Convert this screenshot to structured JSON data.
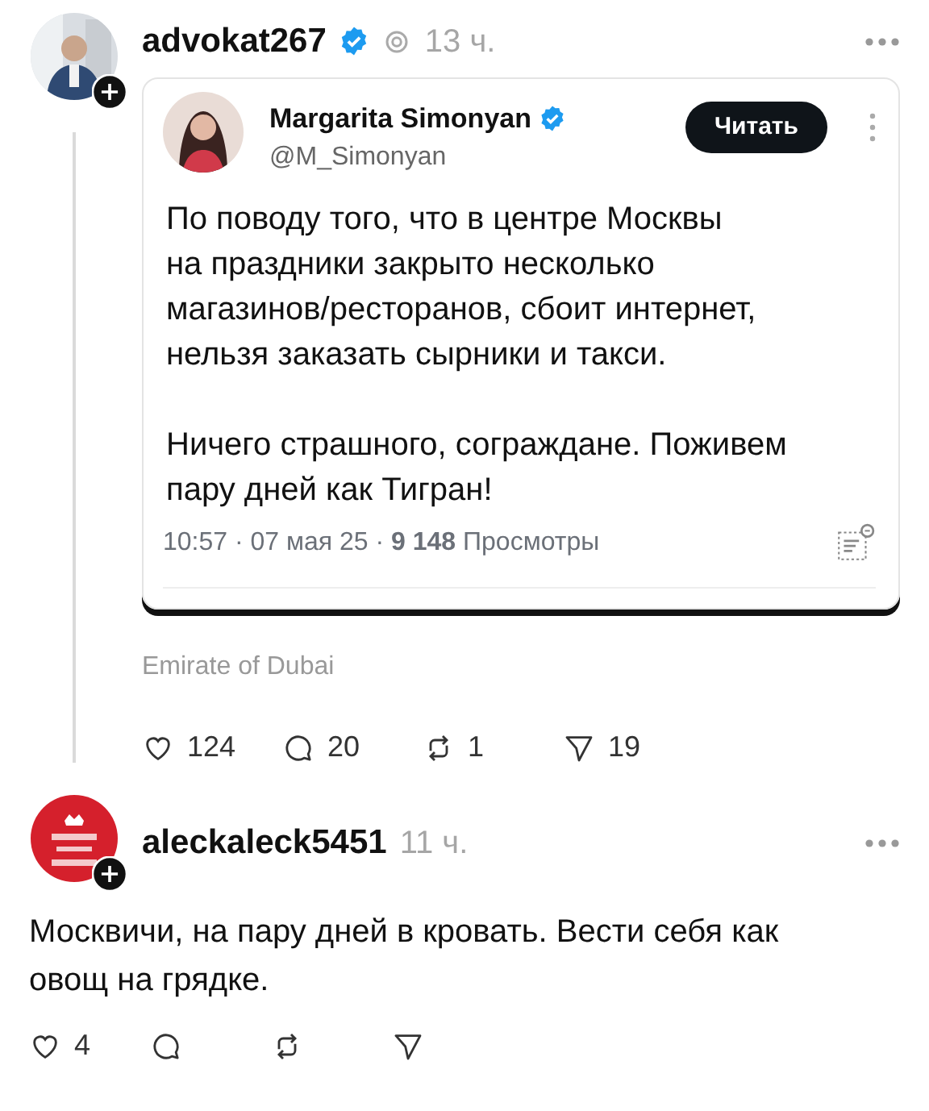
{
  "posts": [
    {
      "username": "advokat267",
      "verified": true,
      "time": "13 ч.",
      "thread_line": true,
      "embed": {
        "name": "Margarita Simonyan",
        "verified": true,
        "handle": "@M_Simonyan",
        "follow_button": "Читать",
        "paragraphs": [
          [
            "По поводу того, что в центре Москвы",
            "на праздники закрыто несколько",
            "магазинов/ресторанов, сбоит интернет,",
            "нельзя заказать сырники и такси."
          ],
          [
            "Ничего страшного, сограждане. Поживем",
            "пару дней как Тигран!"
          ]
        ],
        "meta": "10:57 · 07 мая 25 · **9 148** Просмотры"
      },
      "location": "Emirate of Dubai",
      "actions": [
        {
          "kind": "like",
          "count": "124"
        },
        {
          "kind": "reply",
          "count": "20"
        },
        {
          "kind": "repost",
          "count": "1"
        },
        {
          "kind": "share",
          "count": "19"
        }
      ]
    },
    {
      "username": "aleckaleck5451",
      "verified": false,
      "time": "11 ч.",
      "thread_line": false,
      "text": "Москвичи, на пару дней в кровать. Вести себя как овощ на грядке.",
      "actions": [
        {
          "kind": "like",
          "count": "4"
        },
        {
          "kind": "reply"
        },
        {
          "kind": "repost"
        },
        {
          "kind": "share"
        }
      ]
    }
  ]
}
